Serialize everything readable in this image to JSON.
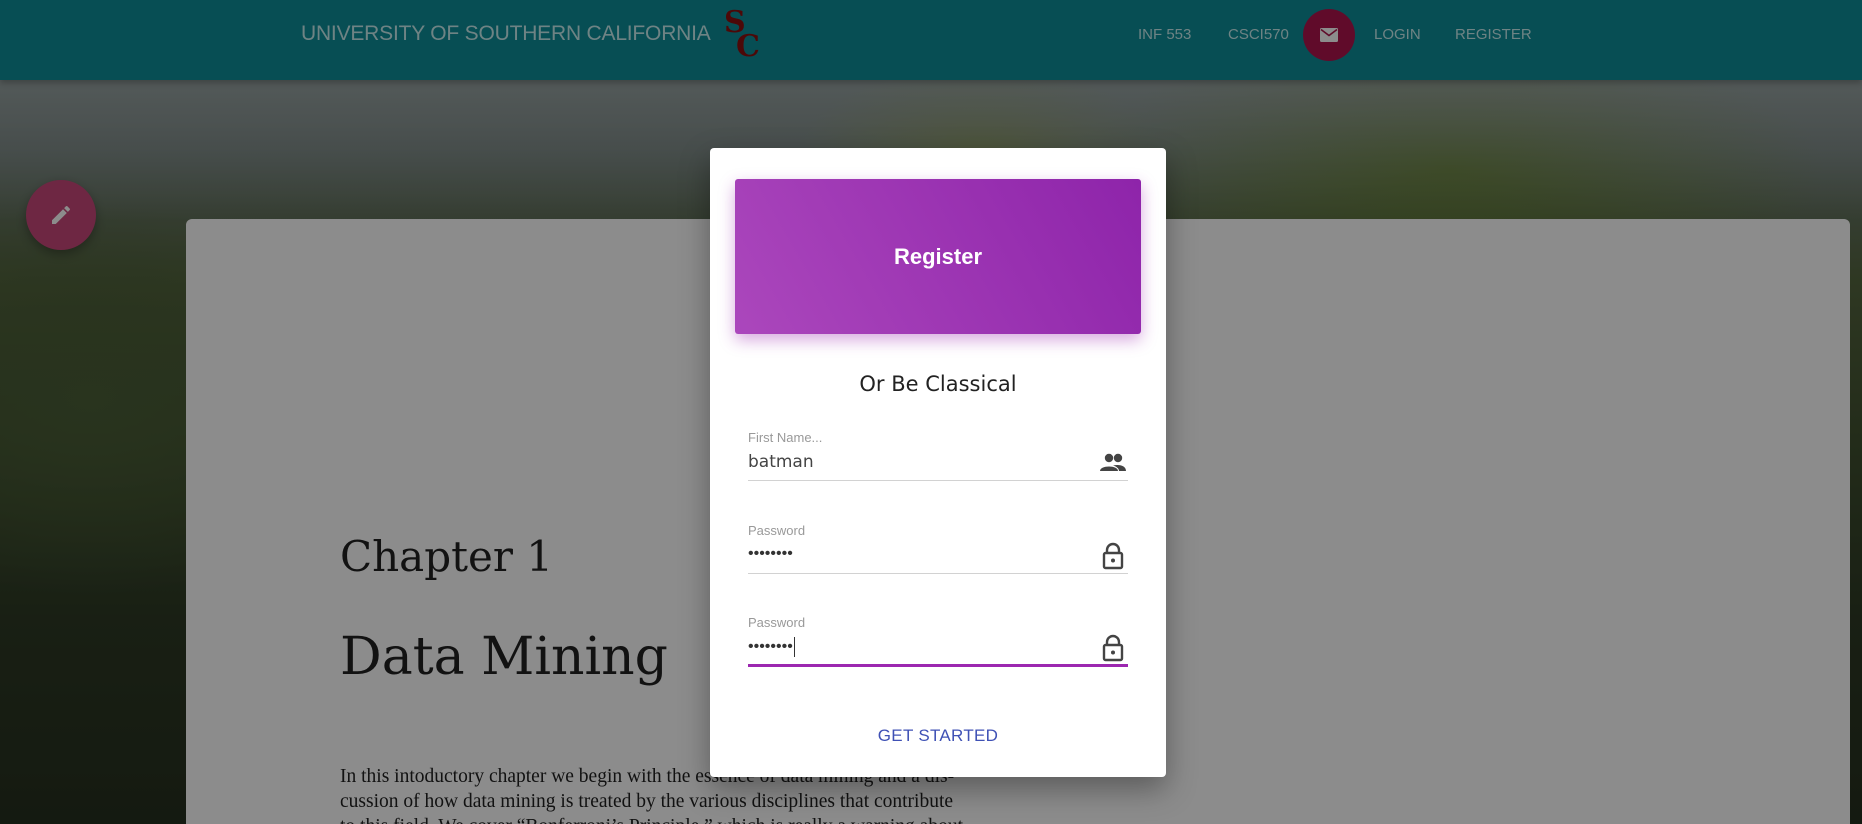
{
  "nav": {
    "brand": "UNIVERSITY OF SOUTHERN CALIFORNIA",
    "logo_icon": "usc-sc-logo",
    "links": [
      "INF 553",
      "CSCI570",
      "LOGIN",
      "REGISTER"
    ],
    "mail_icon": "mail-icon"
  },
  "page": {
    "chapter_number": "Chapter 1",
    "chapter_title": "Data Mining",
    "body_line1": "In this intoductory chapter we begin with the essence of data mining and a dis-",
    "body_line2": "cussion of how data mining is treated by the various disciplines that contribute",
    "body_line3": "to this field. We cover “Bonferroni’s Principle,” which is really a warning about",
    "fab_icon": "pencil-icon"
  },
  "modal": {
    "header_title": "Register",
    "subtitle": "Or Be Classical",
    "fields": [
      {
        "label": "First Name...",
        "value": "batman",
        "icon": "people-icon"
      },
      {
        "label": "Password",
        "value": "••••••••",
        "icon": "lock-icon"
      },
      {
        "label": "Password",
        "value": "••••••••",
        "icon": "lock-icon"
      }
    ],
    "submit_label": "GET STARTED"
  },
  "colors": {
    "nav_bg": "#0e8f99",
    "accent_purple": "#9c27b0",
    "mail_button": "#b0154e",
    "link_blue": "#3f51b5"
  }
}
